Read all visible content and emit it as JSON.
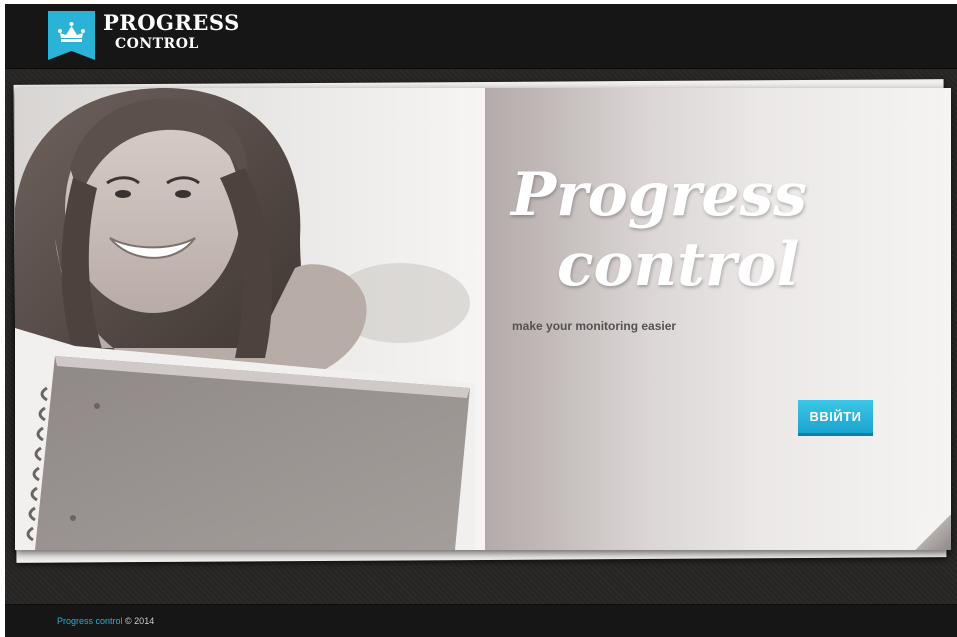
{
  "header": {
    "logo_line1": "PROGRESS",
    "logo_line2": "CONTROL",
    "logo_icon": "crown-icon",
    "badge_color": "#2ab3d6"
  },
  "hero": {
    "title_line1": "Progress",
    "title_line2": "control",
    "tagline": "make your monitoring easier",
    "login_label": "ВВІЙТИ",
    "accent_color": "#2ab3d6"
  },
  "footer": {
    "link_text": "Progress control",
    "copyright": "© 2014"
  }
}
